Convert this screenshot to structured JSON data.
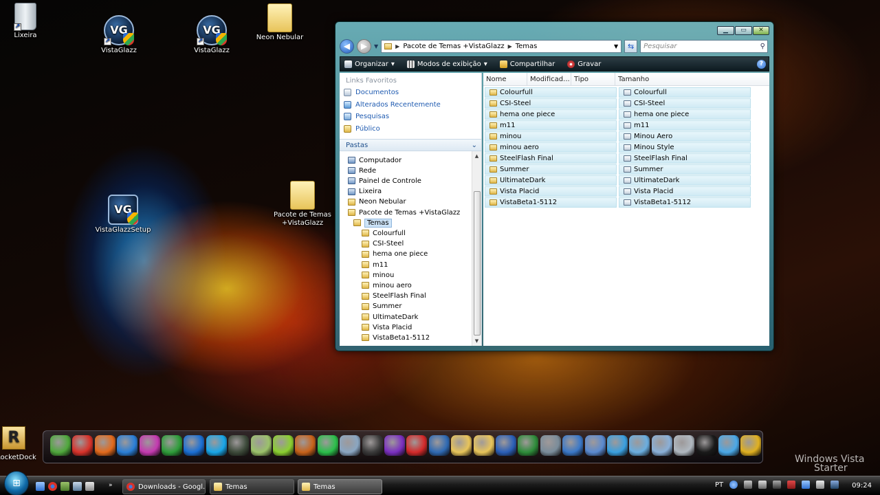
{
  "desktop": {
    "icons": [
      {
        "label": "Lixeira",
        "icon": "recycle-bin-icon"
      },
      {
        "label": "VistaGlazz",
        "icon": "vistaglazz-icon"
      },
      {
        "label": "VistaGlazz",
        "icon": "vistaglazz-icon"
      },
      {
        "label": "Neon Nebular",
        "icon": "folder-icon"
      },
      {
        "label": "VistaGlazzSetup",
        "icon": "setup-icon"
      },
      {
        "label": "Pacote de Temas +VistaGlazz",
        "icon": "folder-icon"
      }
    ]
  },
  "explorer": {
    "address": {
      "crumbs": [
        "Pacote de Temas +VistaGlazz",
        "Temas"
      ],
      "search_placeholder": "Pesquisar"
    },
    "toolbar": {
      "organize": "Organizar",
      "views": "Modos de exibição",
      "share": "Compartilhar",
      "burn": "Gravar",
      "help": "?"
    },
    "favorites": {
      "title": "Links Favoritos",
      "items": [
        "Documentos",
        "Alterados Recentemente",
        "Pesquisas",
        "Público"
      ]
    },
    "folders": {
      "title": "Pastas",
      "tree": [
        {
          "label": "Computador",
          "depth": 1
        },
        {
          "label": "Rede",
          "depth": 1
        },
        {
          "label": "Painel de Controle",
          "depth": 1
        },
        {
          "label": "Lixeira",
          "depth": 1
        },
        {
          "label": "Neon Nebular",
          "depth": 1
        },
        {
          "label": "Pacote de Temas +VistaGlazz",
          "depth": 1
        },
        {
          "label": "Temas",
          "depth": 2,
          "selected": true
        },
        {
          "label": "Colourfull",
          "depth": 3
        },
        {
          "label": "CSI-Steel",
          "depth": 3
        },
        {
          "label": "hema one piece",
          "depth": 3
        },
        {
          "label": "m11",
          "depth": 3
        },
        {
          "label": "minou",
          "depth": 3
        },
        {
          "label": "minou aero",
          "depth": 3
        },
        {
          "label": "SteelFlash Final",
          "depth": 3
        },
        {
          "label": "Summer",
          "depth": 3
        },
        {
          "label": "UltimateDark",
          "depth": 3
        },
        {
          "label": "Vista Placid",
          "depth": 3
        },
        {
          "label": "VistaBeta1-5112",
          "depth": 3
        }
      ]
    },
    "columns": [
      "Nome",
      "Modificad...",
      "Tipo",
      "Tamanho"
    ],
    "files": [
      {
        "name": "Colourfull",
        "kind": "folder"
      },
      {
        "name": "CSI-Steel",
        "kind": "folder"
      },
      {
        "name": "hema one piece",
        "kind": "folder"
      },
      {
        "name": "m11",
        "kind": "folder"
      },
      {
        "name": "minou",
        "kind": "folder"
      },
      {
        "name": "minou aero",
        "kind": "folder"
      },
      {
        "name": "SteelFlash Final",
        "kind": "folder"
      },
      {
        "name": "Summer",
        "kind": "folder"
      },
      {
        "name": "UltimateDark",
        "kind": "folder"
      },
      {
        "name": "Vista Placid",
        "kind": "folder"
      },
      {
        "name": "VistaBeta1-5112",
        "kind": "folder"
      },
      {
        "name": "Colourfull",
        "kind": "theme"
      },
      {
        "name": "CSI-Steel",
        "kind": "theme"
      },
      {
        "name": "hema one piece",
        "kind": "theme"
      },
      {
        "name": "m11",
        "kind": "theme"
      },
      {
        "name": "Minou Aero",
        "kind": "theme"
      },
      {
        "name": "Minou Style",
        "kind": "theme"
      },
      {
        "name": "SteelFlash Final",
        "kind": "theme"
      },
      {
        "name": "Summer",
        "kind": "theme"
      },
      {
        "name": "UltimateDark",
        "kind": "theme"
      },
      {
        "name": "Vista Placid",
        "kind": "theme"
      },
      {
        "name": "VistaBeta1-5112",
        "kind": "theme"
      }
    ]
  },
  "dock": {
    "label": "RocketDock",
    "icons": [
      {
        "name": "messenger-icon",
        "color": "#4fa83c"
      },
      {
        "name": "chrome-icon",
        "color": "#d8322a"
      },
      {
        "name": "firefox-icon",
        "color": "#e36a1c"
      },
      {
        "name": "internet-explorer-icon",
        "color": "#2a7fd8"
      },
      {
        "name": "picasa-icon",
        "color": "#c43ab0"
      },
      {
        "name": "mushroom-icon",
        "color": "#2e9d3a"
      },
      {
        "name": "teamviewer-icon",
        "color": "#1a6fd4"
      },
      {
        "name": "skype-icon",
        "color": "#18a6e8"
      },
      {
        "name": "usb-icon",
        "color": "#3d4a3a"
      },
      {
        "name": "notepad-icon",
        "color": "#9bc26a"
      },
      {
        "name": "forward-arrows-icon",
        "color": "#8bcf30"
      },
      {
        "name": "xfire-icon",
        "color": "#c8621a"
      },
      {
        "name": "sims-icon",
        "color": "#2bbf4a"
      },
      {
        "name": "burner-icon",
        "color": "#8aa6c2"
      },
      {
        "name": "hp-icon",
        "color": "#3a3a3a"
      },
      {
        "name": "studio-icon",
        "color": "#7a2fc0"
      },
      {
        "name": "nero-icon",
        "color": "#d42a2a"
      },
      {
        "name": "network-icon",
        "color": "#2f6ab4"
      },
      {
        "name": "folder-icon",
        "color": "#e8c45a"
      },
      {
        "name": "folder-icon",
        "color": "#e8c45a"
      },
      {
        "name": "word-icon",
        "color": "#2a5fb8"
      },
      {
        "name": "excel-icon",
        "color": "#2e8c3a"
      },
      {
        "name": "calculator-icon",
        "color": "#7a8c9a"
      },
      {
        "name": "computer-icon",
        "color": "#3a78c8"
      },
      {
        "name": "control-panel-icon",
        "color": "#5a8ad0"
      },
      {
        "name": "globe-icon",
        "color": "#3aa0e0"
      },
      {
        "name": "folder-blue-icon",
        "color": "#6aaee0"
      },
      {
        "name": "music-folder-icon",
        "color": "#8ab0d8"
      },
      {
        "name": "recycle-bin-icon",
        "color": "#b0b8c0"
      },
      {
        "name": "tshirt-icon",
        "color": "#1a1a1a"
      },
      {
        "name": "internet-icon",
        "color": "#4aa8e8"
      },
      {
        "name": "tools-icon",
        "color": "#e0b020"
      }
    ]
  },
  "brand": {
    "line1": "Windows Vista",
    "line2": "Starter"
  },
  "taskbar": {
    "tasks": [
      {
        "label": "Downloads - Googl...",
        "color": "#d8322a",
        "active": false
      },
      {
        "label": "Temas",
        "color": "#e8c45a",
        "active": false
      },
      {
        "label": "Temas",
        "color": "#e8c45a",
        "active": true
      }
    ],
    "tray_lang": "PT",
    "clock": "09:24"
  }
}
